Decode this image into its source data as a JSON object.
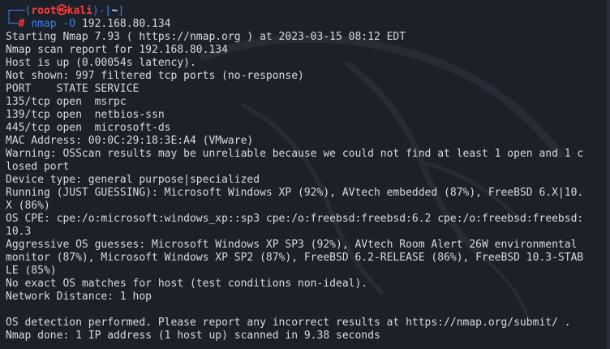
{
  "prompt": {
    "top_corner": "┌──(",
    "user": "root",
    "skull": "㉿",
    "host": "kali",
    "mid": ")-[",
    "cwd": "~",
    "close": "]",
    "bottom_corner": "└─",
    "hash": "#",
    "command": "nmap",
    "flag": "-O",
    "target": "192.168.80.134"
  },
  "output_lines": [
    "Starting Nmap 7.93 ( https://nmap.org ) at 2023-03-15 08:12 EDT",
    "Nmap scan report for 192.168.80.134",
    "Host is up (0.00054s latency).",
    "Not shown: 997 filtered tcp ports (no-response)",
    "PORT    STATE SERVICE",
    "135/tcp open  msrpc",
    "139/tcp open  netbios-ssn",
    "445/tcp open  microsoft-ds",
    "MAC Address: 00:0C:29:18:3E:A4 (VMware)",
    "Warning: OSScan results may be unreliable because we could not find at least 1 open and 1 c",
    "losed port",
    "Device type: general purpose|specialized",
    "Running (JUST GUESSING): Microsoft Windows XP (92%), AVtech embedded (87%), FreeBSD 6.X|10.",
    "X (86%)",
    "OS CPE: cpe:/o:microsoft:windows_xp::sp3 cpe:/o:freebsd:freebsd:6.2 cpe:/o:freebsd:freebsd:",
    "10.3",
    "Aggressive OS guesses: Microsoft Windows XP SP3 (92%), AVtech Room Alert 26W environmental",
    "monitor (87%), Microsoft Windows XP SP2 (87%), FreeBSD 6.2-RELEASE (86%), FreeBSD 10.3-STAB",
    "LE (85%)",
    "No exact OS matches for host (test conditions non-ideal).",
    "Network Distance: 1 hop",
    "",
    "OS detection performed. Please report any incorrect results at https://nmap.org/submit/ .",
    "Nmap done: 1 IP address (1 host up) scanned in 9.38 seconds"
  ],
  "colors": {
    "background": "#1c2029",
    "text": "#d7dbe0",
    "prompt_blue": "#3f7fe6",
    "prompt_red": "#ff3b3b"
  }
}
